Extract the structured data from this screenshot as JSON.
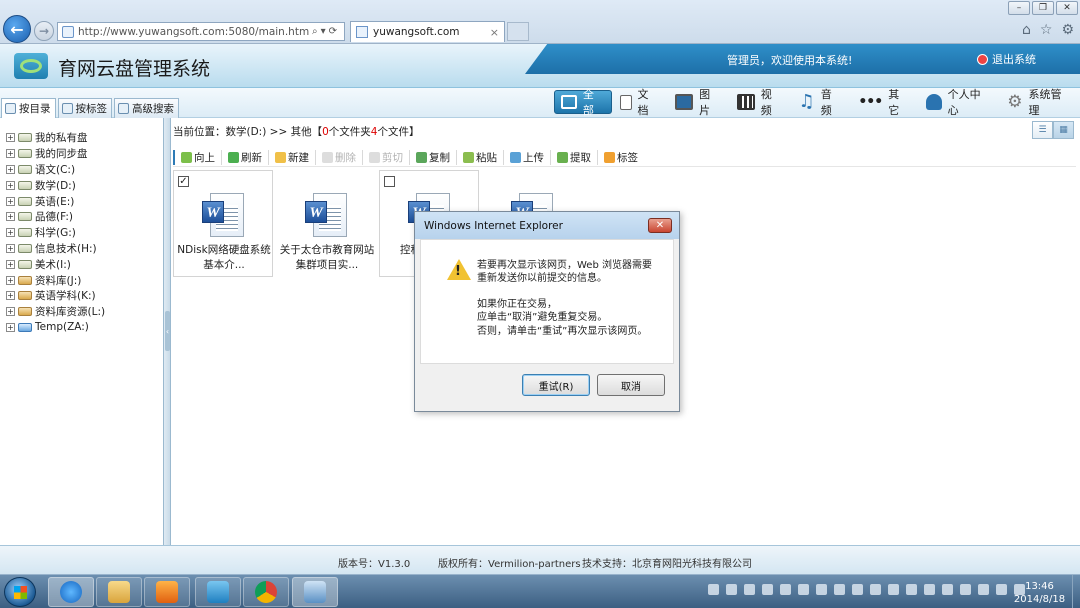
{
  "browser": {
    "url": "http://www.yuwangsoft.com:5080/main.htm",
    "tab_title": "yuwangsoft.com",
    "tab_close": "×",
    "window_buttons": [
      "–",
      "❐",
      "✕"
    ]
  },
  "header": {
    "title": "育网云盘管理系统",
    "welcome": "管理员，欢迎使用本系统!",
    "logout": "退出系统"
  },
  "side_tabs": [
    {
      "label": "按目录",
      "active": true
    },
    {
      "label": "按标签",
      "active": false
    },
    {
      "label": "高级搜索",
      "active": false
    }
  ],
  "categories": [
    {
      "label": "全部",
      "icon": "grid-icon",
      "active": true
    },
    {
      "label": "文档",
      "icon": "document-icon"
    },
    {
      "label": "图片",
      "icon": "image-icon"
    },
    {
      "label": "视频",
      "icon": "video-icon"
    },
    {
      "label": "音频",
      "icon": "music-icon"
    },
    {
      "label": "其它",
      "icon": "more-icon"
    },
    {
      "label": "个人中心",
      "icon": "user-icon"
    },
    {
      "label": "系统管理",
      "icon": "gear-icon"
    }
  ],
  "tree": [
    {
      "label": "我的私有盘",
      "type": "drive"
    },
    {
      "label": "我的同步盘",
      "type": "drive"
    },
    {
      "label": "语文(C:)",
      "type": "drive"
    },
    {
      "label": "数学(D:)",
      "type": "drive"
    },
    {
      "label": "英语(E:)",
      "type": "drive"
    },
    {
      "label": "品德(F:)",
      "type": "drive"
    },
    {
      "label": "科学(G:)",
      "type": "drive"
    },
    {
      "label": "信息技术(H:)",
      "type": "drive"
    },
    {
      "label": "美术(I:)",
      "type": "drive"
    },
    {
      "label": "资料库(J:)",
      "type": "folder"
    },
    {
      "label": "英语学科(K:)",
      "type": "folder"
    },
    {
      "label": "资料库资源(L:)",
      "type": "folder"
    },
    {
      "label": "Temp(ZA:)",
      "type": "net"
    }
  ],
  "breadcrumb": {
    "prefix": "当前位置：数学(D:) >> 其他【",
    "folder_count": "0",
    "mid": "个文件夹",
    "file_count": "4",
    "suffix": "个文件】"
  },
  "actions": [
    {
      "label": "向上",
      "enabled": true
    },
    {
      "label": "刷新",
      "enabled": true
    },
    {
      "label": "新建",
      "enabled": true
    },
    {
      "label": "删除",
      "enabled": false
    },
    {
      "label": "剪切",
      "enabled": false
    },
    {
      "label": "复制",
      "enabled": true
    },
    {
      "label": "粘贴",
      "enabled": true
    },
    {
      "label": "上传",
      "enabled": true
    },
    {
      "label": "提取",
      "enabled": true
    },
    {
      "label": "标签",
      "enabled": true
    }
  ],
  "files": [
    {
      "name": "NDisk网络硬盘系统基本介...",
      "checked": true,
      "check_mark": "✓"
    },
    {
      "name": "关于太仓市教育网站集群项目实...",
      "checked": false
    },
    {
      "name": "控科",
      "checked": false
    },
    {
      "name": "",
      "checked": false
    }
  ],
  "dialog": {
    "title": "Windows Internet Explorer",
    "close": "✕",
    "lines": [
      "若要再次显示该网页，Web 浏览器需要",
      "重新发送你以前提交的信息。",
      "",
      "如果你正在交易，",
      "应单击“取消”避免重复交易。",
      "否则，请单击“重试”再次显示该网页。"
    ],
    "retry": "重试(R)",
    "cancel": "取消"
  },
  "footer": {
    "version": "版本号：V1.3.0",
    "copyright": "版权所有：Vermilion-partners",
    "support": "技术支持：北京育网阳光科技有限公司"
  },
  "taskbar": {
    "time": "13:46",
    "date": "2014/8/18"
  }
}
